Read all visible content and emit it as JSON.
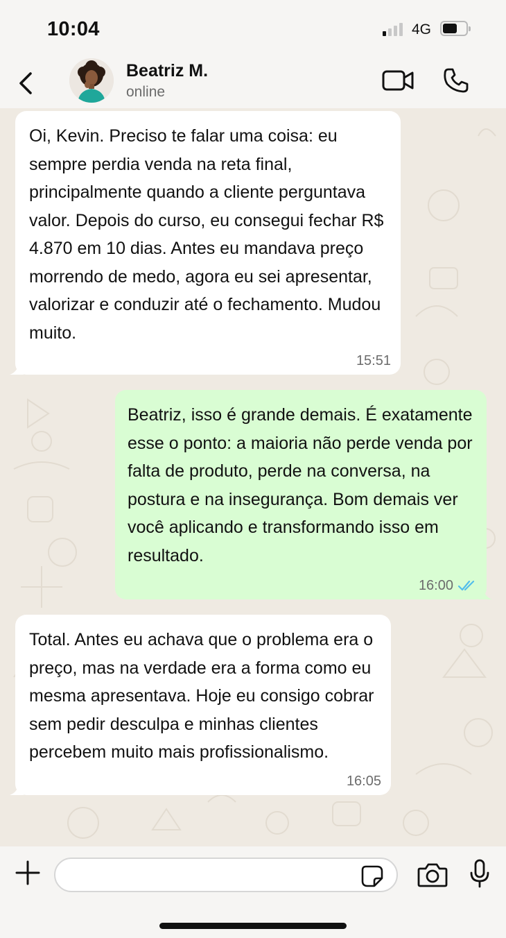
{
  "status_bar": {
    "time": "10:04",
    "network": "4G",
    "signal_bars_active": 1,
    "signal_bars_total": 4
  },
  "header": {
    "contact_name": "Beatriz M.",
    "contact_status": "online",
    "avatar_icon": "contact-avatar",
    "back_icon": "chevron-left-icon",
    "video_icon": "video-call-icon",
    "phone_icon": "phone-icon"
  },
  "messages": [
    {
      "direction": "incoming",
      "text": "Oi, Kevin. Preciso te falar uma coisa: eu sempre perdia venda na reta final, principalmente quando a cliente perguntava valor. Depois do curso, eu consegui fechar R$ 4.870 em 10 dias. Antes eu mandava preço morrendo de medo, agora eu sei apresentar, valorizar e conduzir até o fechamento. Mudou muito.",
      "time": "15:51"
    },
    {
      "direction": "outgoing",
      "text": "Beatriz, isso é grande demais. É exatamente esse o ponto: a maioria não perde venda por falta de produto, perde na conversa, na postura e na insegurança. Bom demais ver você aplicando e transformando isso em resultado.",
      "time": "16:00",
      "read": true
    },
    {
      "direction": "incoming",
      "text": "Total. Antes eu achava que o problema era o preço, mas na verdade era a forma como eu mesma apresentava. Hoje eu consigo cobrar sem pedir desculpa e minhas clientes percebem muito mais profissionalismo.",
      "time": "16:05"
    }
  ],
  "input_bar": {
    "placeholder": "",
    "value": "",
    "icons": [
      "plus-icon",
      "sticker-icon",
      "camera-icon",
      "microphone-icon"
    ]
  },
  "colors": {
    "chat_background": "#efeae2",
    "incoming_bubble": "#ffffff",
    "outgoing_bubble": "#d9fdd3",
    "read_ticks": "#53bdeb",
    "bars_background": "#f6f5f3"
  }
}
